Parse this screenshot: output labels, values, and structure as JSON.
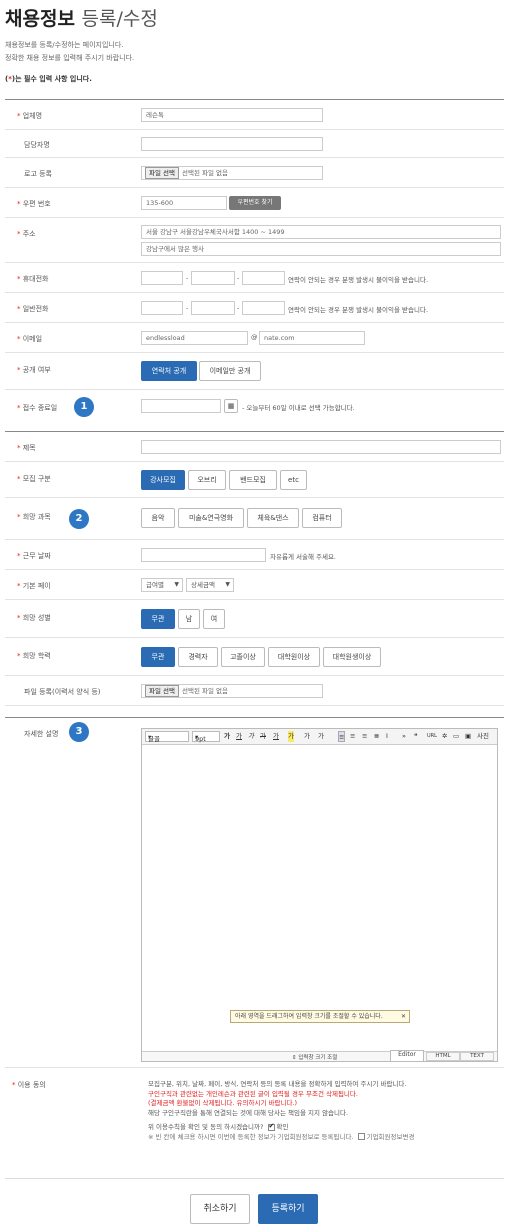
{
  "header": {
    "title": "채용정보",
    "title2": "등록/수정",
    "line1": "채용정보를 등록/수정하는 페이지입니다.",
    "line2": "정확한 채용 정보를 입력해 주시기 바랍니다.",
    "req_prefix": "(",
    "req_star": "*",
    "req_suffix": ")는 필수 입력 사항 입니다."
  },
  "fields": {
    "company": {
      "label": "업체명",
      "value": "레슨톡"
    },
    "manager": {
      "label": "담당자명"
    },
    "logo": {
      "label": "로고 등록",
      "btn": "파일 선택",
      "none": "선택된 파일 없음"
    },
    "zip": {
      "label": "우편 번호",
      "value": "135-600",
      "btn": "우편번호 찾기"
    },
    "addr": {
      "label": "주소",
      "value1": "서울 강남구 서울강남우체국사서함 1400 ~ 1499",
      "value2": "강남구에서 많은 행사"
    },
    "mobile": {
      "label": "휴대전화",
      "dash": "-",
      "hint": "연락이 안되는 경우 분쟁 발생시 불이익을 받습니다."
    },
    "phone": {
      "label": "일반전화",
      "dash": "-",
      "hint": "연락이 안되는 경우 분쟁 발생시 불이익을 받습니다."
    },
    "email": {
      "label": "이메일",
      "id": "endlessload",
      "at": "@",
      "domain": "nate.com"
    },
    "public": {
      "label": "공개 여부",
      "opt1": "연락처 공개",
      "opt2": "이메일만 공개"
    },
    "deadline": {
      "label": "접수 종료일",
      "hint": "- 오늘부터 60일 이내로 선택 가능합니다.",
      "badge": "1"
    },
    "title": {
      "label": "제목"
    },
    "type": {
      "label": "모집 구분",
      "opts": [
        "강사모집",
        "오브리",
        "밴드모집",
        "etc"
      ]
    },
    "course": {
      "label": "희망 과목",
      "badge": "2",
      "opts": [
        "음악",
        "미술&연극영화",
        "체육&댄스",
        "컴퓨터"
      ]
    },
    "hours": {
      "label": "근무 날짜",
      "hint": "자유롭게 서술해 주세요."
    },
    "pay": {
      "label": "기본 페이",
      "sel1": "급여별",
      "sel2": "상세금액"
    },
    "gender": {
      "label": "희망 성별",
      "opts": [
        "무관",
        "남",
        "여"
      ]
    },
    "edu": {
      "label": "희망 학력",
      "opts": [
        "무관",
        "경력자",
        "고졸이상",
        "대학원이상",
        "대학원생이상"
      ]
    },
    "resume": {
      "label": "파일 등록(이력서 양식 등)",
      "btn": "파일 선택",
      "none": "선택된 파일 없음"
    },
    "detail": {
      "label": "자세한 설명",
      "badge": "3"
    }
  },
  "editor": {
    "font": "글꼴",
    "size": "9pt",
    "b": "가",
    "u": "가",
    "i": "가",
    "s": "가",
    "c1": "가",
    "c2": "가",
    "sup": "가",
    "sub": "가",
    "photo": "사진",
    "tip": "아래 영역을 드래그하여 입력창 크기를 조절할 수 있습니다.",
    "resize": "입력창 크기 조절",
    "tabs": [
      "Editor",
      "HTML",
      "TEXT"
    ]
  },
  "agree": {
    "label": "이용 동의",
    "l1": "모집구분, 위치, 날짜, 페이, 방식, 연락처 등의 등록 내용을 정확하게 입력하여 주시기 바랍니다.",
    "l2": "구인구직과 관련없는 개인레슨과 관련된 글이 입력될 경우 무조건 삭제됩니다.",
    "l3": "(결제금액 환불없이 삭제됩니다. 유의하시기 바랍니다.)",
    "l4": "해당 구인구직란을 통해 연결되는 것에 대해 당사는 책임을 지지 않습니다.",
    "q": "위 이용수칙을 확인 및 동의 하시겠습니까?",
    "ok": "확인",
    "note": "※ 빈 칸에 체크용 하시면 이번에 등록한 정보가 기업회원정보로 등록됩니다.",
    "note2": "기업회원정보변경"
  },
  "buttons": {
    "cancel": "취소하기",
    "submit": "등록하기"
  },
  "colors": {
    "accent": "#2a6bb3",
    "required": "#e02020",
    "badge": "#2d77c4"
  }
}
